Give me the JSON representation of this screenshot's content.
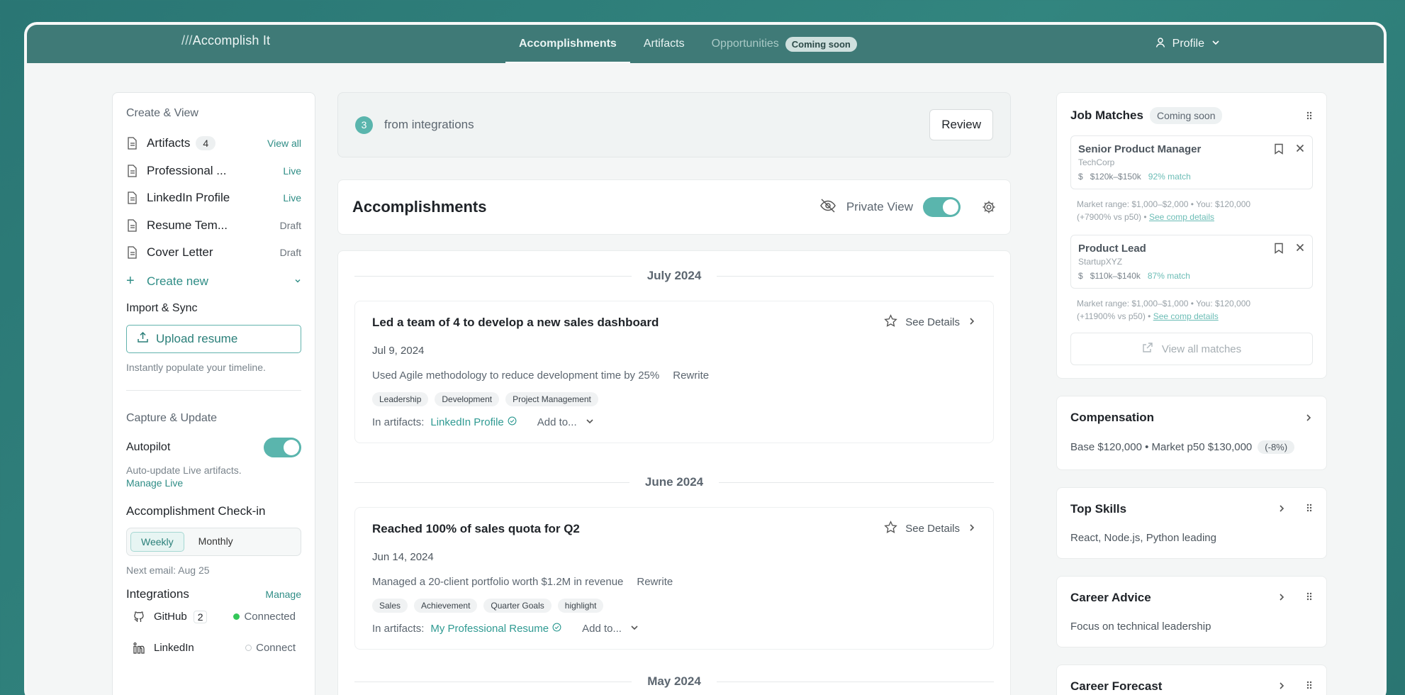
{
  "app": {
    "brand_slashes": "///",
    "brand_name": "Accomplish It",
    "nav": [
      {
        "label": "Accomplishments"
      },
      {
        "label": "Artifacts"
      },
      {
        "label": "Opportunities",
        "badge": "Coming soon"
      }
    ],
    "profile_label": "Profile"
  },
  "sidebar": {
    "create_view_title": "Create & View",
    "artifacts_label": "Artifacts",
    "artifacts_count": "4",
    "view_all": "View all",
    "items": [
      {
        "name": "Professional ...",
        "status": "Live"
      },
      {
        "name": "LinkedIn Profile",
        "status": "Live"
      },
      {
        "name": "Resume Tem...",
        "status": "Draft"
      },
      {
        "name": "Cover Letter",
        "status": "Draft"
      }
    ],
    "create_new": "Create new",
    "import_title": "Import & Sync",
    "upload_label": "Upload resume",
    "upload_hint": "Instantly populate your timeline.",
    "capture_title": "Capture & Update",
    "autopilot_label": "Autopilot",
    "autopilot_on": true,
    "autopilot_hint": "Auto-update Live artifacts.",
    "manage_live": "Manage Live",
    "checkin_title": "Accomplishment Check-in",
    "checkin_options": [
      "Weekly",
      "Monthly"
    ],
    "checkin_selected": "Weekly",
    "next_email": "Next email: Aug 25",
    "integrations_title": "Integrations",
    "integrations_manage": "Manage",
    "integrations": [
      {
        "name": "GitHub",
        "count": "2",
        "state": "Connected",
        "dot_color": "#34c759"
      },
      {
        "name": "LinkedIn",
        "count": "",
        "state": "Connect",
        "dot_color": "#ffffff"
      }
    ]
  },
  "center": {
    "integ_count": "3",
    "integ_text": "from integrations",
    "review_label": "Review",
    "heading": "Accomplishments",
    "private_view_label": "Private View",
    "private_view_on": true,
    "months": [
      {
        "label": "July 2024",
        "entries": [
          {
            "title": "Led a team of 4 to develop a new sales dashboard",
            "date": "Jul 9, 2024",
            "desc": "Used Agile methodology to reduce development time by 25%",
            "rewrite": "Rewrite",
            "tags": [
              "Leadership",
              "Development",
              "Project Management"
            ],
            "in_artifacts_label": "In artifacts:",
            "artifact_link": "LinkedIn Profile",
            "add_to": "Add to..."
          }
        ]
      },
      {
        "label": "June 2024",
        "entries": [
          {
            "title": "Reached 100% of sales quota for Q2",
            "date": "Jun 14, 2024",
            "desc": "Managed a 20-client portfolio worth $1.2M in revenue",
            "rewrite": "Rewrite",
            "tags": [
              "Sales",
              "Achievement",
              "Quarter Goals",
              "highlight"
            ],
            "in_artifacts_label": "In artifacts:",
            "artifact_link": "My Professional Resume",
            "add_to": "Add to..."
          }
        ]
      },
      {
        "label": "May 2024",
        "entries": []
      }
    ],
    "see_details": "See Details"
  },
  "right": {
    "job_matches_title": "Job Matches",
    "job_matches_badge": "Coming soon",
    "jobs": [
      {
        "title": "Senior Product Manager",
        "company": "TechCorp",
        "salary": "$120k–$150k",
        "match": "92% match",
        "market_line1": "Market range: $1,000–$2,000 • You: $120,000",
        "market_line2": "(+7900% vs p50) •",
        "comp_link": "See comp details"
      },
      {
        "title": "Product Lead",
        "company": "StartupXYZ",
        "salary": "$110k–$140k",
        "match": "87% match",
        "market_line1": "Market range: $1,000–$1,000 • You: $120,000",
        "market_line2": "(+11900% vs p50) •",
        "comp_link": "See comp details"
      }
    ],
    "view_all_matches": "View all matches",
    "compensation_title": "Compensation",
    "compensation_text": "Base $120,000 • Market p50 $130,000",
    "compensation_pct": "(-8%)",
    "top_skills_title": "Top Skills",
    "top_skills_text": "React, Node.js, Python leading",
    "career_advice_title": "Career Advice",
    "career_advice_text": "Focus on technical leadership",
    "career_forecast_title": "Career Forecast"
  },
  "colors": {
    "accent": "#2f8d86",
    "topbar": "#3f7a77",
    "toggle_on": "#5ab5ad"
  }
}
